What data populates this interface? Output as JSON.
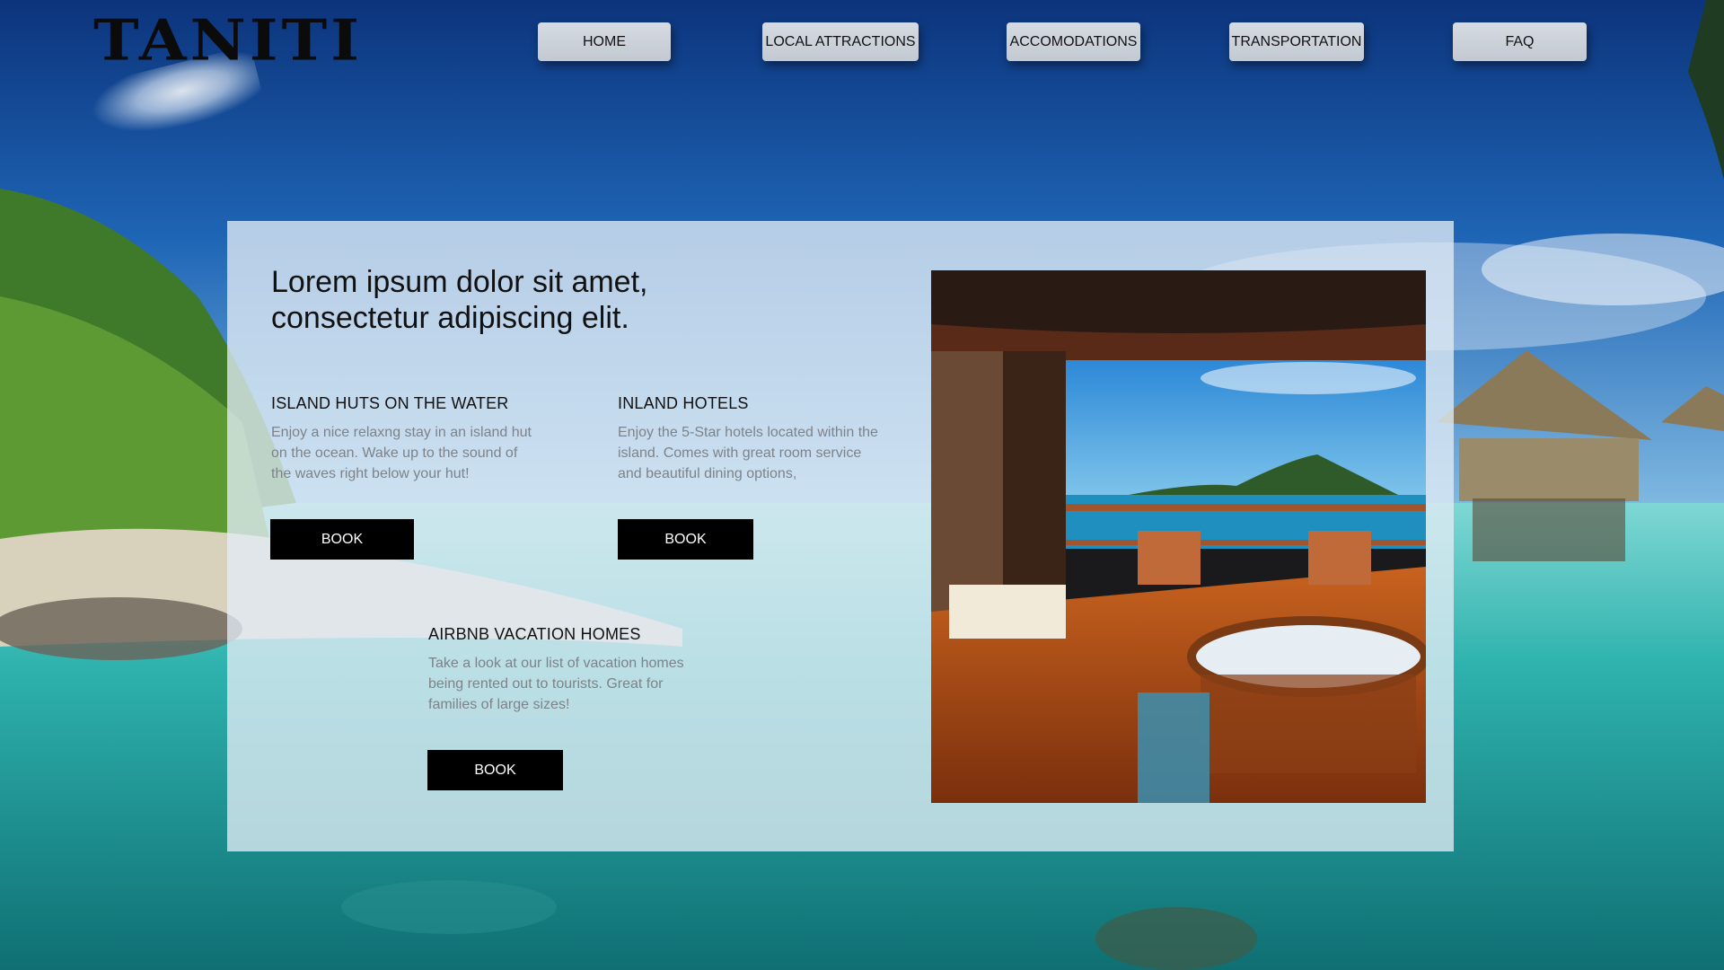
{
  "brand": {
    "logo_text": "TANITI"
  },
  "nav": {
    "items": [
      {
        "label": "HOME"
      },
      {
        "label": "LOCAL ATTRACTIONS"
      },
      {
        "label": "ACCOMODATIONS"
      },
      {
        "label": "TRANSPORTATION"
      },
      {
        "label": "FAQ"
      }
    ]
  },
  "main": {
    "headline_line1": "Lorem ipsum dolor sit amet,",
    "headline_line2": "consectetur adipiscing elit.",
    "cards": [
      {
        "title": "ISLAND HUTS ON THE WATER",
        "description": "Enjoy a nice relaxng stay in an island hut on the ocean. Wake up to the sound of the waves right below your hut!",
        "button_label": "BOOK"
      },
      {
        "title": "INLAND HOTELS",
        "description": "Enjoy the 5-Star hotels located within the island. Comes with great room service and beautiful dining options,",
        "button_label": "BOOK"
      },
      {
        "title": "AIRBNB VACATION HOMES",
        "description": "Take a look at our list of vacation homes being rented out to tourists. Great for families of large sizes!",
        "button_label": "BOOK"
      }
    ]
  },
  "colors": {
    "sky": "#0d3f8f",
    "sea": "#2fb3b0",
    "panel": "#e1ecf5",
    "button": "#000000",
    "nav_button": "#cdd2da"
  }
}
